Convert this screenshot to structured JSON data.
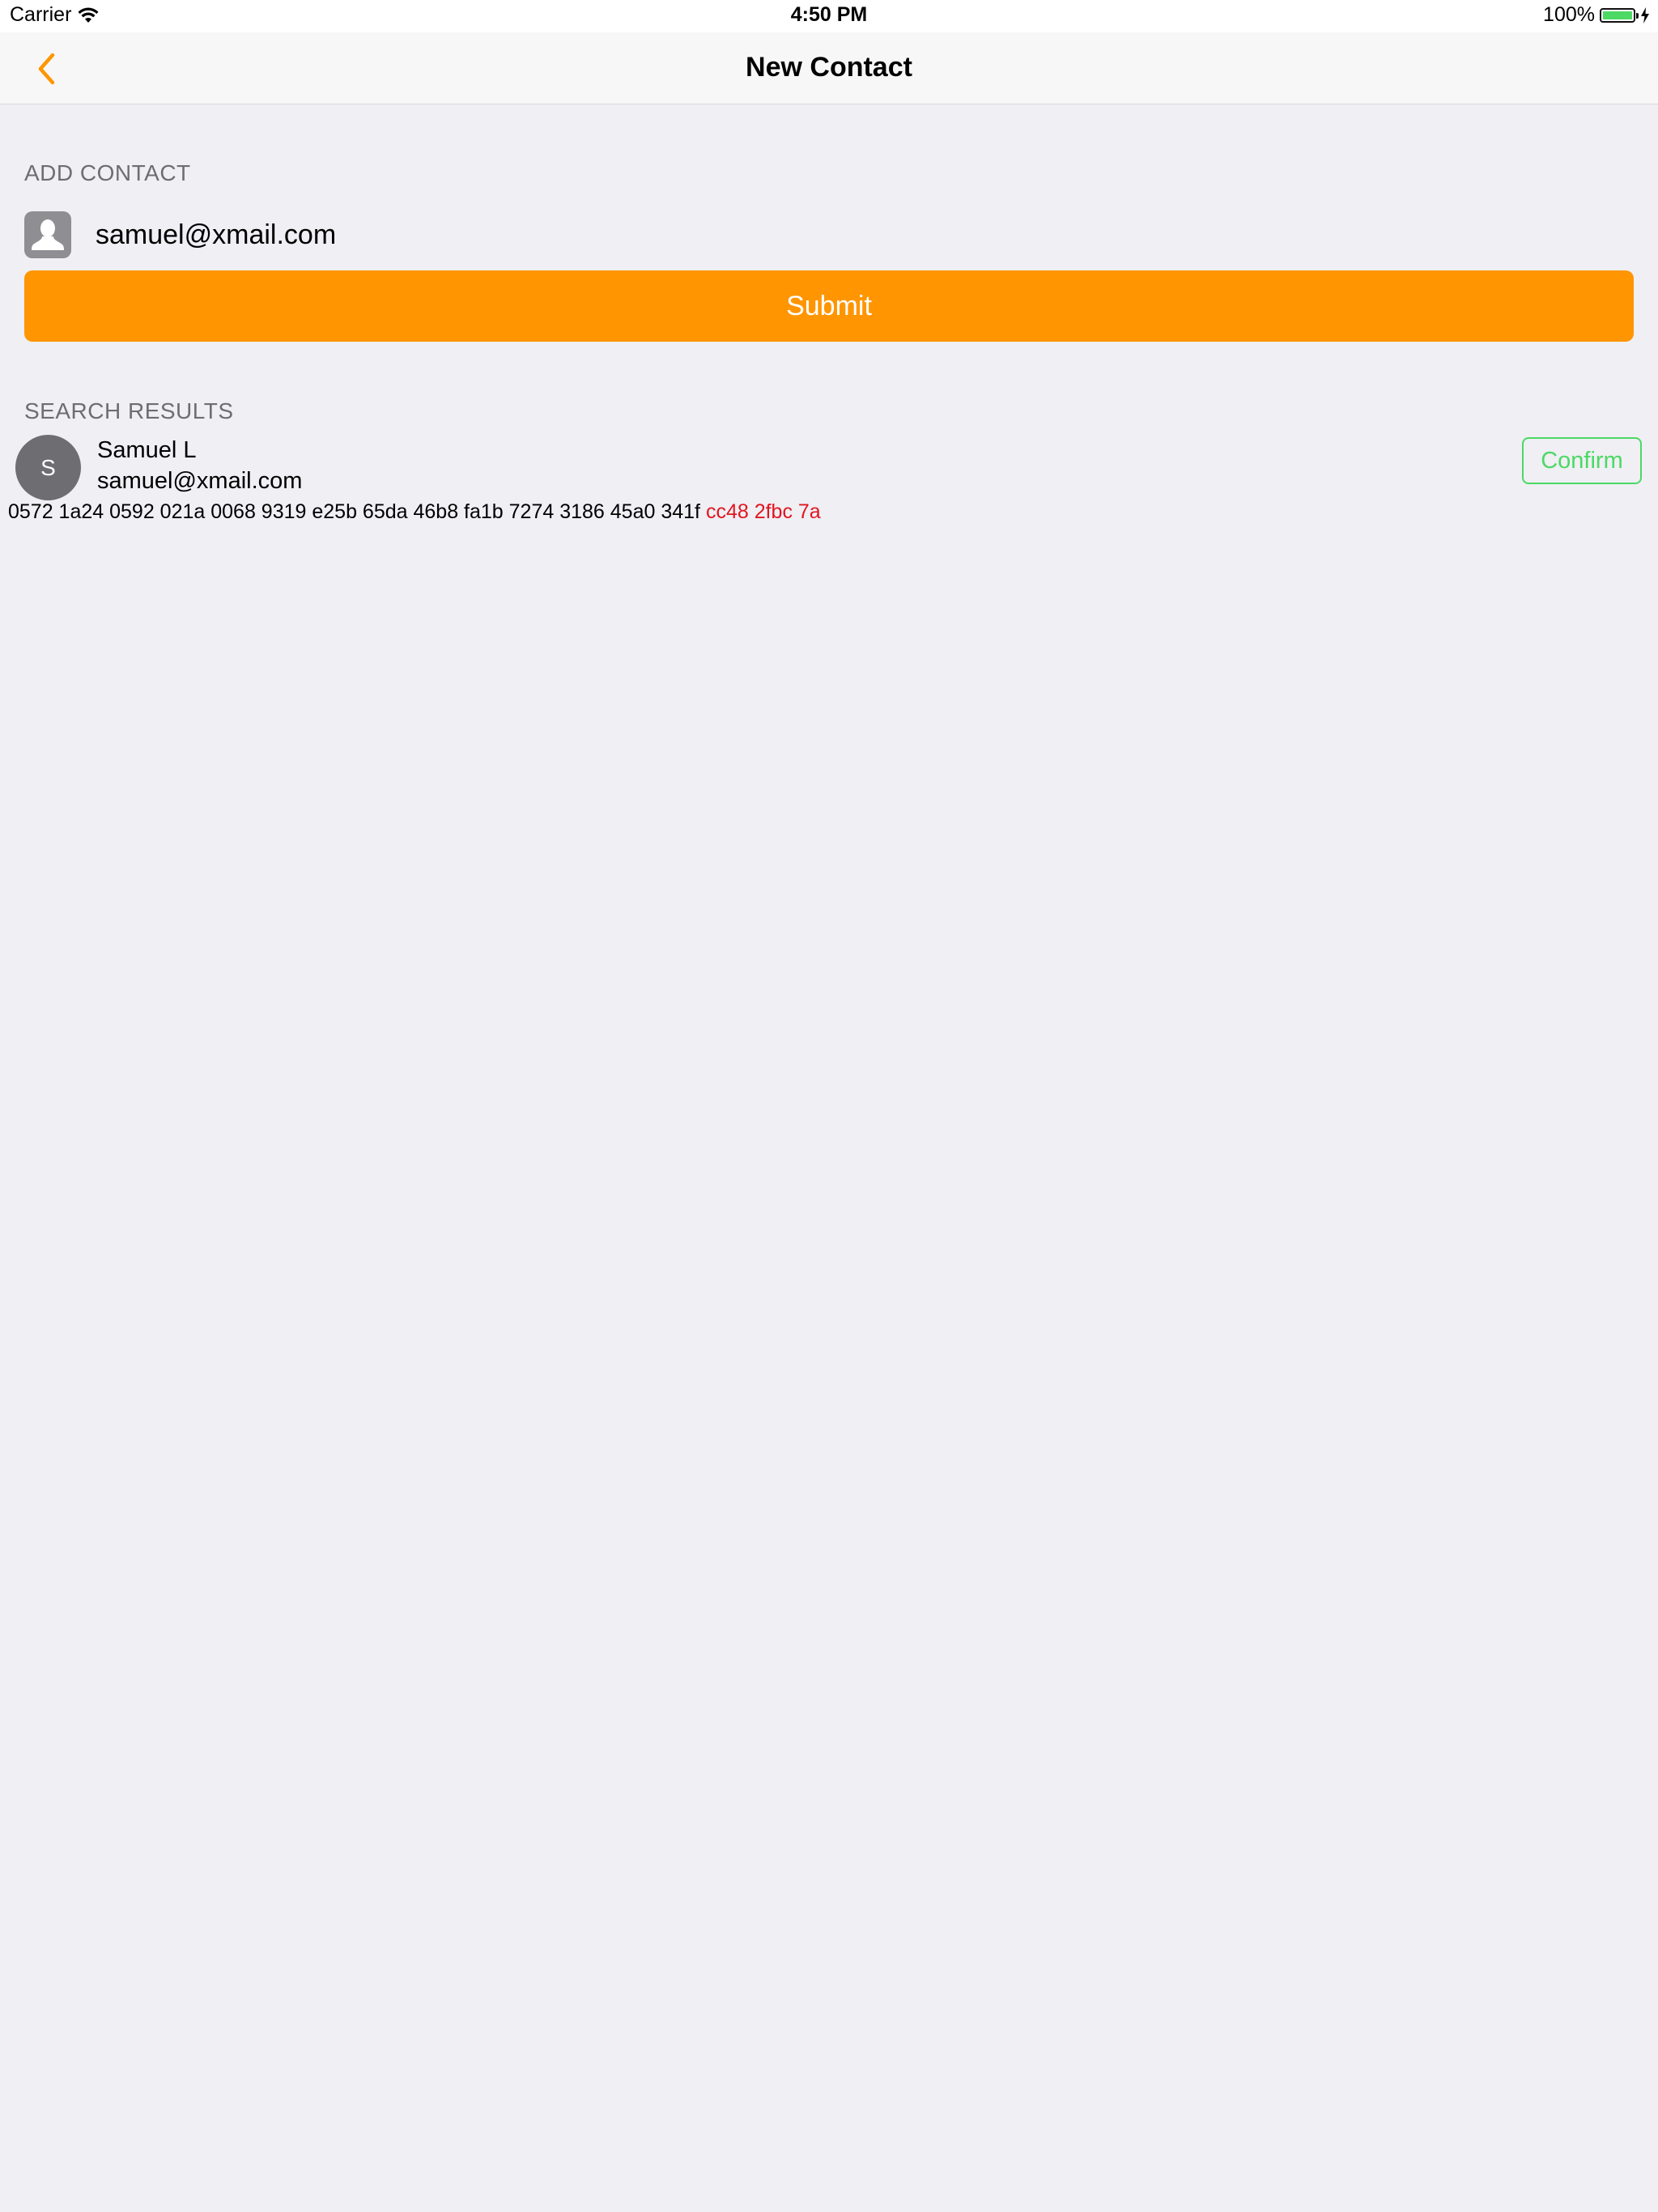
{
  "status_bar": {
    "carrier": "Carrier",
    "time": "4:50 PM",
    "battery_percent": "100%",
    "battery_level": 1.0,
    "battery_color": "#4cd964"
  },
  "nav": {
    "title": "New Contact",
    "back_icon": "chevron-left-icon",
    "accent_color": "#ff9500"
  },
  "add_contact": {
    "header": "ADD CONTACT",
    "icon": "person-icon",
    "input_value": "samuel@xmail.com",
    "submit_label": "Submit",
    "submit_color": "#ff9500"
  },
  "search_results": {
    "header": "SEARCH RESULTS",
    "items": [
      {
        "avatar_initial": "S",
        "name": "Samuel L",
        "email": "samuel@xmail.com",
        "fingerprint_main": "0572 1a24 0592 021a 0068 9319 e25b 65da 46b8 fa1b 7274 3186 45a0 341f",
        "fingerprint_highlight": "cc48 2fbc 7a",
        "highlight_color": "#e0161f",
        "confirm_label": "Confirm",
        "confirm_color": "#4cd964"
      }
    ]
  }
}
